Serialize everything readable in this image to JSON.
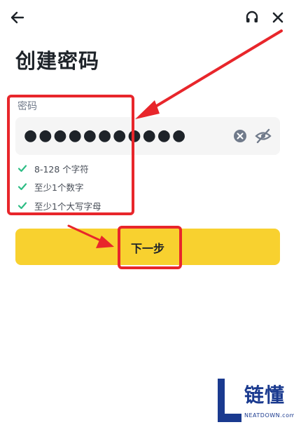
{
  "header": {
    "back_icon": "arrow-left-icon",
    "support_icon": "headset-icon",
    "close_icon": "close-icon"
  },
  "page": {
    "title": "创建密码"
  },
  "password": {
    "label": "密码",
    "masked_value": "●●●●●●●●●●●",
    "clear_icon": "clear-circle-icon",
    "visibility_icon": "eye-off-icon"
  },
  "requirements": [
    {
      "text": "8-128 个字符",
      "met": true
    },
    {
      "text": "至少1个数字",
      "met": true
    },
    {
      "text": "至少1个大写字母",
      "met": true
    }
  ],
  "actions": {
    "next_label": "下一步"
  },
  "colors": {
    "accent": "#f8d12f",
    "check": "#2ebd85",
    "annotation": "#e8262b",
    "input_bg": "#f5f5f5"
  },
  "watermark": {
    "logo_letter": "L",
    "chars": "链懂",
    "sub": "NEATDOWN.com"
  }
}
